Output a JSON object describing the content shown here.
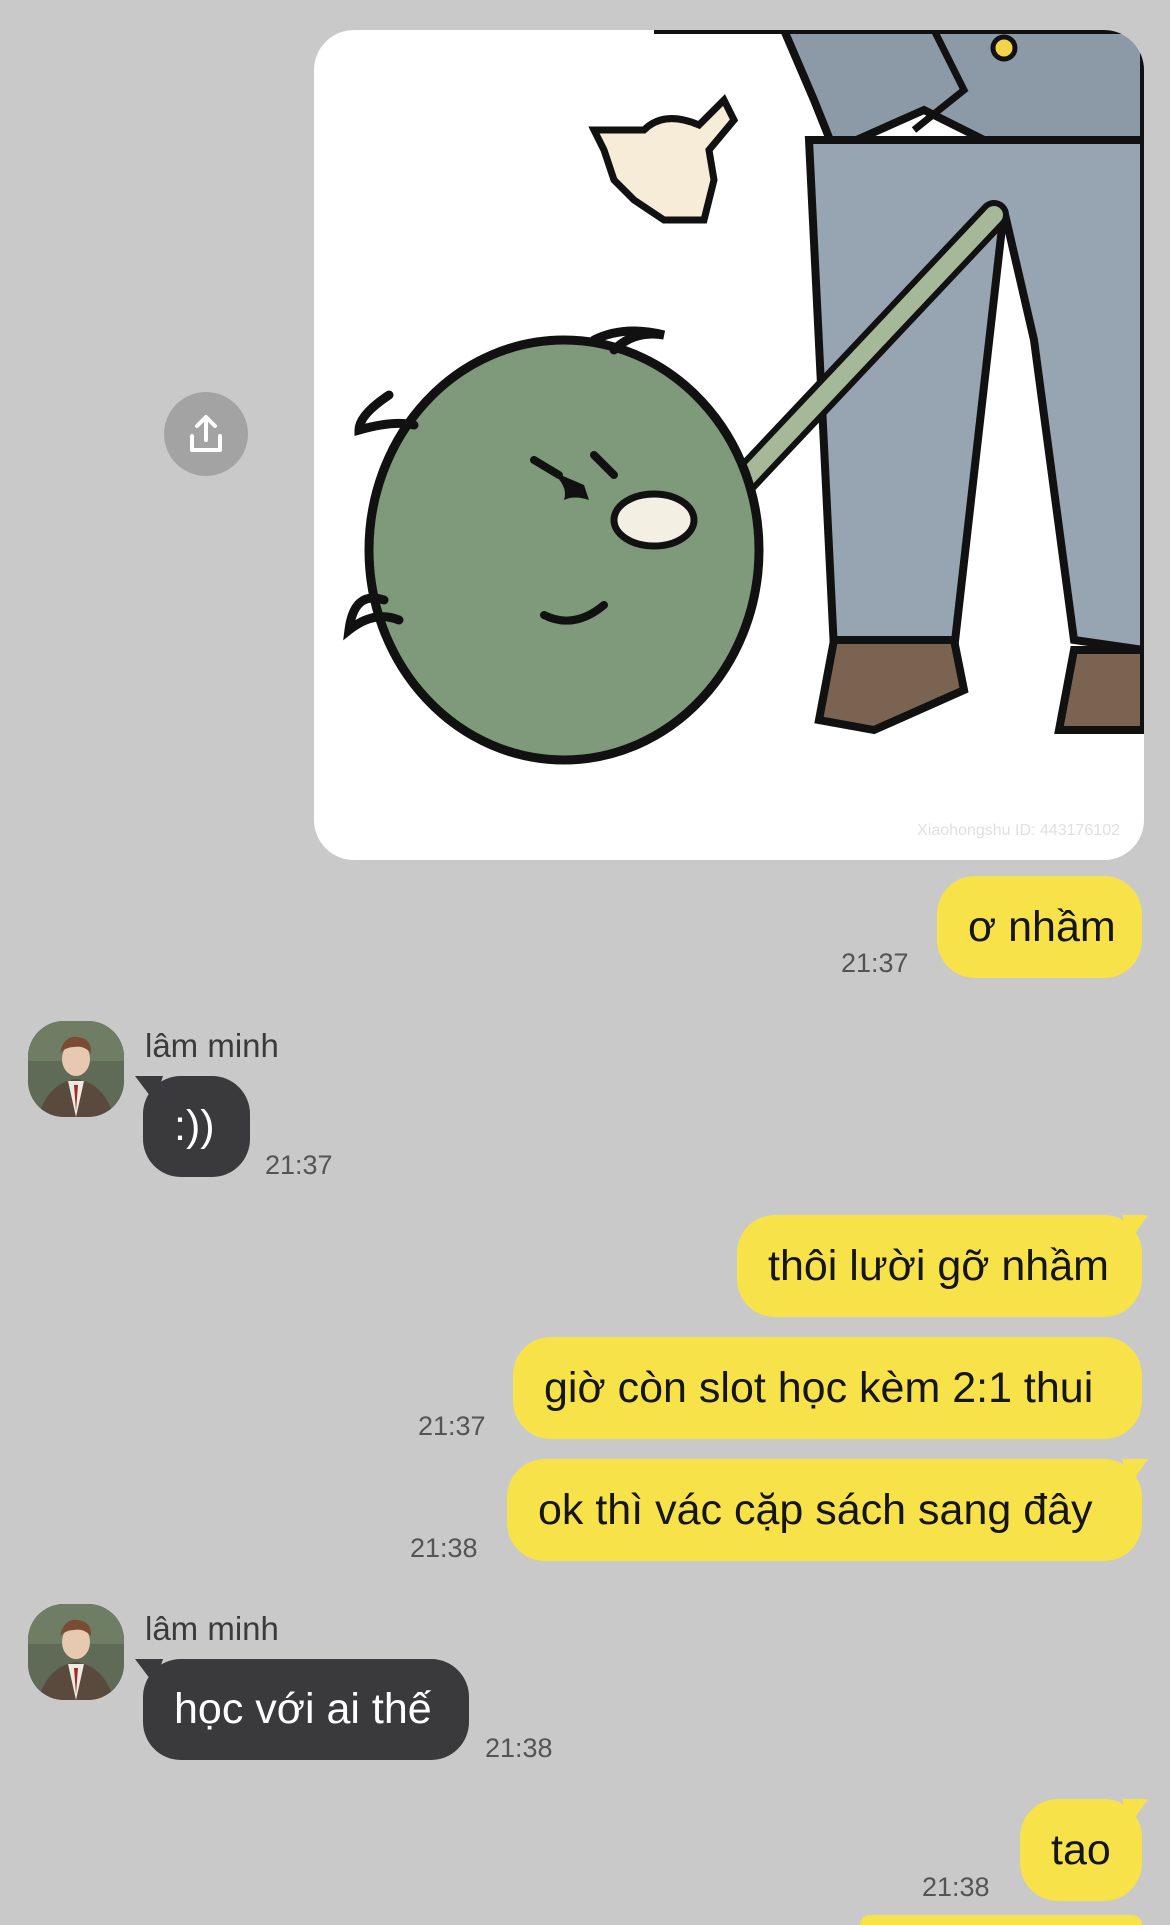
{
  "chat": {
    "image_message": {
      "watermark": "Xiaohongshu ID: 443176102",
      "share_icon": "share-upload-icon"
    },
    "messages": [
      {
        "sender": "me",
        "text": "ơ nhầm",
        "time": "21:37"
      },
      {
        "sender": "lâm minh",
        "text": ":))",
        "time": "21:37"
      },
      {
        "sender": "me",
        "text": "thôi lười gỡ nhầm"
      },
      {
        "sender": "me",
        "text": "giờ còn slot học kèm 2:1 thui",
        "time": "21:37"
      },
      {
        "sender": "me",
        "text": "ok thì vác cặp sách sang đây",
        "time": "21:38"
      },
      {
        "sender": "lâm minh",
        "text": "học với ai thế",
        "time": "21:38"
      },
      {
        "sender": "me",
        "text": "tao",
        "time": "21:38"
      }
    ],
    "contact": {
      "name": "lâm minh",
      "avatar_icon": "contact-avatar"
    },
    "colors": {
      "background": "#c9c9c9",
      "my_bubble": "#f8e24a",
      "their_bubble": "#3a3a3c"
    }
  }
}
